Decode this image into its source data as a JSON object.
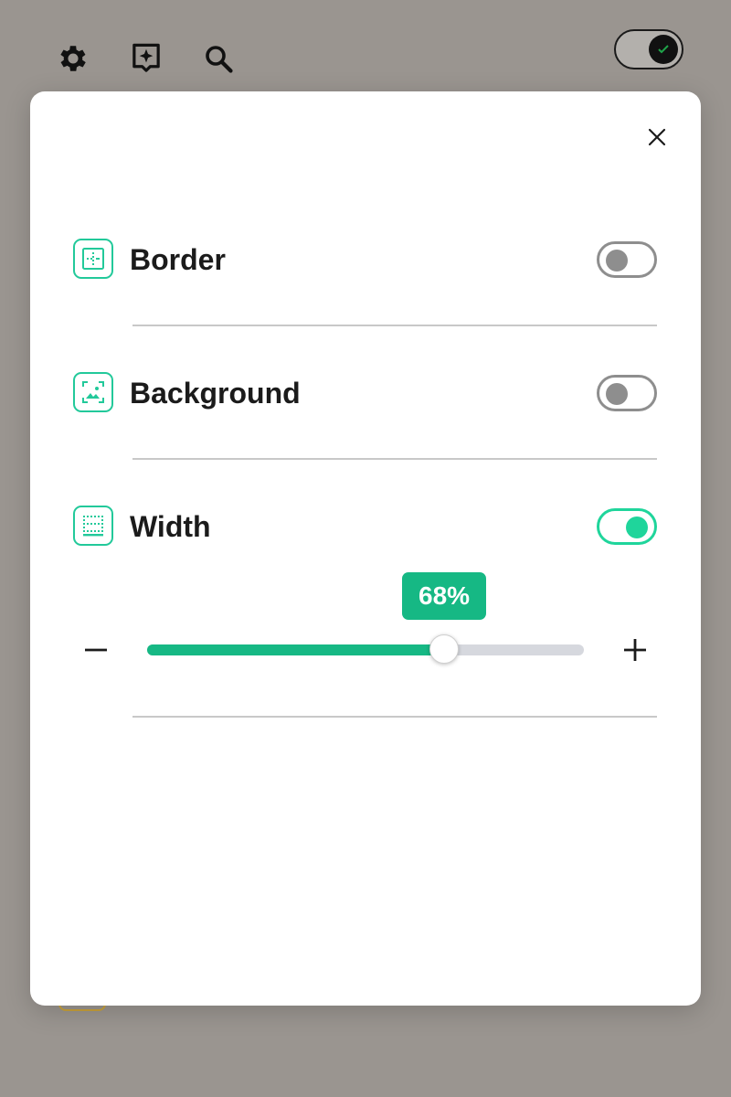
{
  "topbar": {
    "icons": [
      "gear-icon",
      "sparkle-badge-icon",
      "search-icon"
    ],
    "theme_toggle_state": "on"
  },
  "dialog": {
    "close_icon": "close-icon",
    "rows": [
      {
        "label": "Border",
        "icon": "border-icon",
        "enabled": false
      },
      {
        "label": "Background",
        "icon": "image-icon",
        "enabled": false
      },
      {
        "label": "Width",
        "icon": "width-icon",
        "enabled": true
      }
    ],
    "width_slider": {
      "value": 68,
      "display": "68%",
      "decrement_symbol": "minus-icon",
      "increment_symbol": "plus-icon"
    }
  },
  "colors": {
    "accent": "#16b884",
    "accent_bright": "#1fd59b",
    "backdrop": "#9a9590",
    "switch_off": "#8e8e8e",
    "track": "#d6d8de"
  }
}
